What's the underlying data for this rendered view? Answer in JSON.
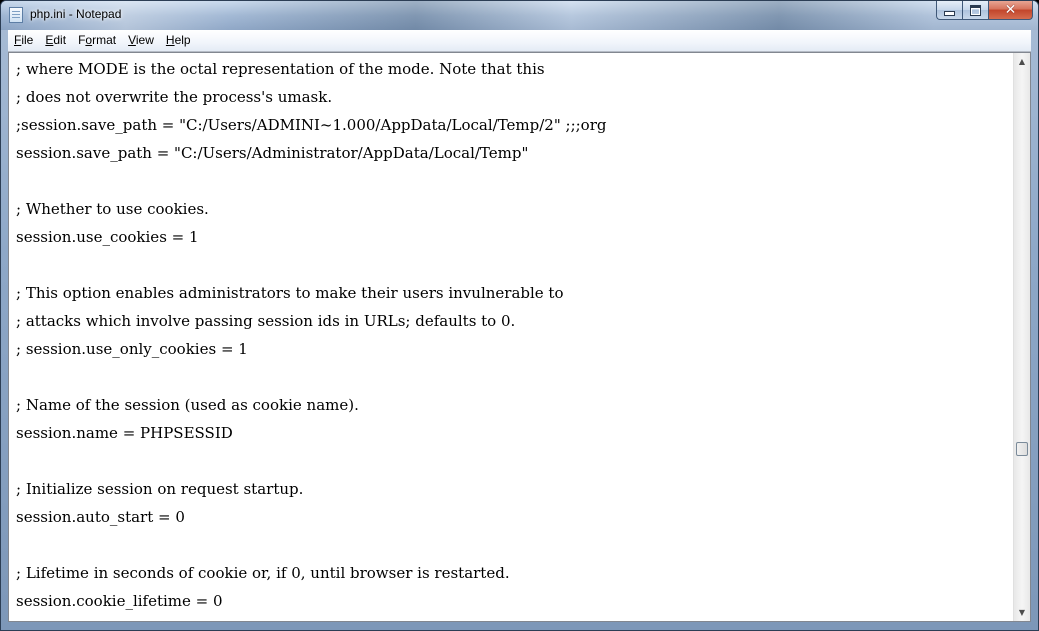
{
  "window": {
    "title": "php.ini - Notepad"
  },
  "caption_buttons": {
    "minimize": "minimize",
    "maximize": "maximize",
    "close_glyph": "✕"
  },
  "menu": {
    "items": [
      {
        "pre": "",
        "key": "F",
        "post": "ile"
      },
      {
        "pre": "",
        "key": "E",
        "post": "dit"
      },
      {
        "pre": "F",
        "key": "o",
        "post": "rmat"
      },
      {
        "pre": "",
        "key": "V",
        "post": "iew"
      },
      {
        "pre": "",
        "key": "H",
        "post": "elp"
      }
    ]
  },
  "editor": {
    "lines": [
      "; where MODE is the octal representation of the mode. Note that this",
      "; does not overwrite the process's umask.",
      ";session.save_path = \"C:/Users/ADMINI~1.000/AppData/Local/Temp/2\" ;;;org",
      "session.save_path = \"C:/Users/Administrator/AppData/Local/Temp\"",
      "",
      "; Whether to use cookies.",
      "session.use_cookies = 1",
      "",
      "; This option enables administrators to make their users invulnerable to",
      "; attacks which involve passing session ids in URLs; defaults to 0.",
      "; session.use_only_cookies = 1",
      "",
      "; Name of the session (used as cookie name).",
      "session.name = PHPSESSID",
      "",
      "; Initialize session on request startup.",
      "session.auto_start = 0",
      "",
      "; Lifetime in seconds of cookie or, if 0, until browser is restarted.",
      "session.cookie_lifetime = 0"
    ]
  },
  "scrollbar": {
    "up_arrow": "▲",
    "down_arrow": "▼",
    "position_fraction": 0.715
  }
}
